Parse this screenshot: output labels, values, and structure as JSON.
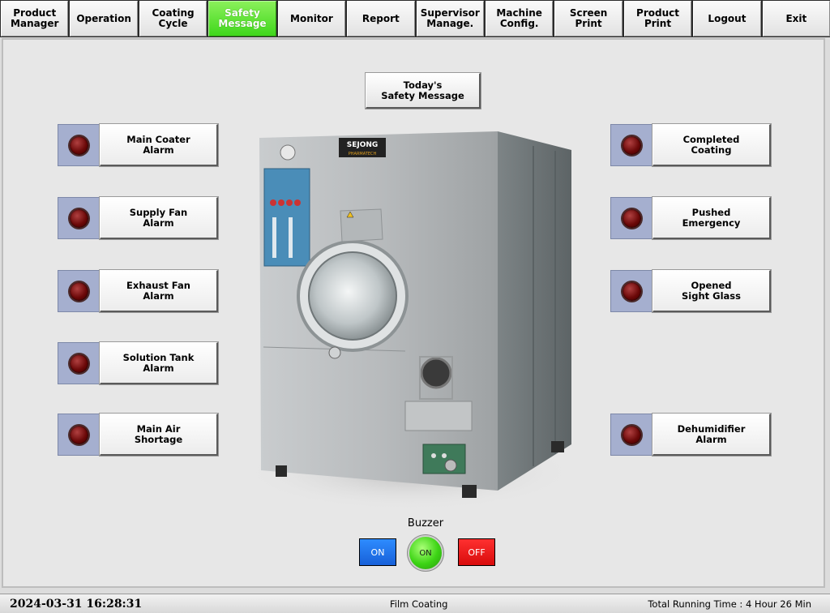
{
  "nav": {
    "items": [
      {
        "label": "Product\nManager"
      },
      {
        "label": "Operation"
      },
      {
        "label": "Coating\nCycle"
      },
      {
        "label": "Safety\nMessage"
      },
      {
        "label": "Monitor"
      },
      {
        "label": "Report"
      },
      {
        "label": "Supervisor\nManage."
      },
      {
        "label": "Machine\nConfig."
      },
      {
        "label": "Screen\nPrint"
      },
      {
        "label": "Product\nPrint"
      },
      {
        "label": "Logout"
      },
      {
        "label": "Exit"
      }
    ],
    "active_item": "Safety\nMessage"
  },
  "main": {
    "today_button": "Today's\nSafety Message",
    "left_alarms": [
      {
        "label": "Main Coater\nAlarm"
      },
      {
        "label": "Supply Fan\nAlarm"
      },
      {
        "label": "Exhaust Fan\nAlarm"
      },
      {
        "label": "Solution Tank\nAlarm"
      },
      {
        "label": "Main Air\nShortage"
      }
    ],
    "right_alarms": [
      {
        "label": "Completed\nCoating"
      },
      {
        "label": "Pushed\nEmergency"
      },
      {
        "label": "Opened\nSight Glass"
      },
      {
        "label": "Dehumidifier\nAlarm"
      }
    ],
    "machine": {
      "brand": "SEJONG",
      "sub_brand": "PHARMATECH"
    }
  },
  "buzzer": {
    "title": "Buzzer",
    "on_label": "ON",
    "lamp_label": "ON",
    "off_label": "OFF"
  },
  "status": {
    "datetime": "2024-03-31  16:28:31",
    "mode": "Film Coating",
    "runtime": "Total Running Time : 4 Hour 26 Min"
  },
  "colors": {
    "active_nav": "#3fd71c",
    "alarm_lamp_off": "#6a0808",
    "buzzer_on": "#1760d8",
    "buzzer_off": "#d80c0c",
    "buzzer_lamp": "#3cd414"
  }
}
